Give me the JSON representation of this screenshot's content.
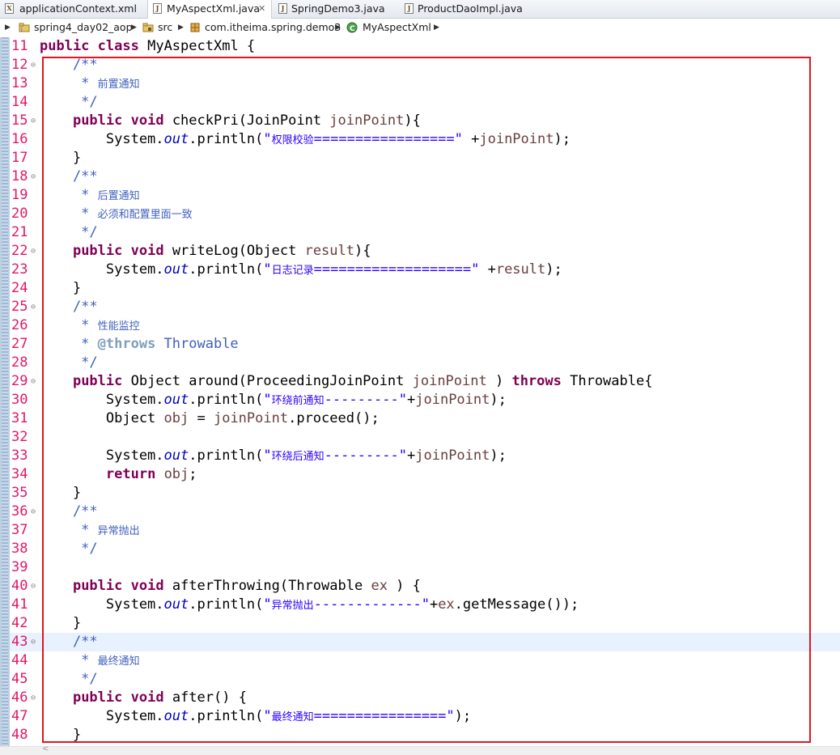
{
  "tabs": [
    {
      "label": "applicationContext.xml",
      "icon": "xml-file-icon",
      "glyph": "X",
      "active": false
    },
    {
      "label": "MyAspectXml.java",
      "icon": "java-file-icon",
      "glyph": "J",
      "active": true,
      "close": "✕"
    },
    {
      "label": "SpringDemo3.java",
      "icon": "java-file-icon",
      "glyph": "J",
      "active": false
    },
    {
      "label": "ProductDaoImpl.java",
      "icon": "java-file-icon",
      "glyph": "J",
      "active": false
    }
  ],
  "breadcrumb": [
    "spring4_day02_aop",
    "src",
    "com.itheima.spring.demo3",
    "MyAspectXml"
  ],
  "colors": {
    "line_number": "#e31669",
    "keyword": "#7f0055",
    "string": "#2a00ff",
    "javadoc": "#3f5fbf",
    "annotation_box": "#e0161e"
  },
  "highlighted_line": "43",
  "code": [
    {
      "n": "11",
      "f": "",
      "tokens": [
        [
          "kw",
          "public"
        ],
        [
          "",
          "​ "
        ],
        [
          "kw",
          "class"
        ],
        [
          "",
          " MyAspectXml {"
        ]
      ]
    },
    {
      "n": "12",
      "f": "⊖",
      "tokens": [
        [
          "dc",
          "    /**"
        ]
      ]
    },
    {
      "n": "13",
      "f": "",
      "tokens": [
        [
          "dc",
          "     * "
        ],
        [
          "dc zh",
          "前置通知"
        ]
      ]
    },
    {
      "n": "14",
      "f": "",
      "tokens": [
        [
          "dc",
          "     */"
        ]
      ]
    },
    {
      "n": "15",
      "f": "⊖",
      "tokens": [
        [
          "",
          "    "
        ],
        [
          "kw",
          "public"
        ],
        [
          "",
          " "
        ],
        [
          "kw",
          "void"
        ],
        [
          "",
          " checkPri(JoinPoint "
        ],
        [
          "var",
          "joinPoint"
        ],
        [
          "",
          "){"
        ]
      ]
    },
    {
      "n": "16",
      "f": "",
      "tokens": [
        [
          "",
          "        System."
        ],
        [
          "fld",
          "out"
        ],
        [
          "",
          ".println("
        ],
        [
          "st",
          "\""
        ],
        [
          "st zh",
          "权限校验"
        ],
        [
          "st",
          "=================\""
        ],
        [
          "",
          " +"
        ],
        [
          "var",
          "joinPoint"
        ],
        [
          "",
          ");"
        ]
      ]
    },
    {
      "n": "17",
      "f": "",
      "tokens": [
        [
          "",
          "    }"
        ]
      ]
    },
    {
      "n": "18",
      "f": "⊖",
      "tokens": [
        [
          "dc",
          "    /**"
        ]
      ]
    },
    {
      "n": "19",
      "f": "",
      "tokens": [
        [
          "dc",
          "     * "
        ],
        [
          "dc zh",
          "后置通知"
        ]
      ]
    },
    {
      "n": "20",
      "f": "",
      "tokens": [
        [
          "dc",
          "     * "
        ],
        [
          "dc zh",
          "必须和配置里面一致"
        ]
      ]
    },
    {
      "n": "21",
      "f": "",
      "tokens": [
        [
          "dc",
          "     */"
        ]
      ]
    },
    {
      "n": "22",
      "f": "⊖",
      "tokens": [
        [
          "",
          "    "
        ],
        [
          "kw",
          "public"
        ],
        [
          "",
          " "
        ],
        [
          "kw",
          "void"
        ],
        [
          "",
          " writeLog(Object "
        ],
        [
          "var",
          "result"
        ],
        [
          "",
          "){"
        ]
      ]
    },
    {
      "n": "23",
      "f": "",
      "tokens": [
        [
          "",
          "        System."
        ],
        [
          "fld",
          "out"
        ],
        [
          "",
          ".println("
        ],
        [
          "st",
          "\""
        ],
        [
          "st zh",
          "日志记录"
        ],
        [
          "st",
          "===================\""
        ],
        [
          "",
          " +"
        ],
        [
          "var",
          "result"
        ],
        [
          "",
          ");"
        ]
      ]
    },
    {
      "n": "24",
      "f": "",
      "tokens": [
        [
          "",
          "    }"
        ]
      ]
    },
    {
      "n": "25",
      "f": "⊖",
      "tokens": [
        [
          "dc",
          "    /**"
        ]
      ]
    },
    {
      "n": "26",
      "f": "",
      "tokens": [
        [
          "dc",
          "     * "
        ],
        [
          "dc zh",
          "性能监控"
        ]
      ]
    },
    {
      "n": "27",
      "f": "",
      "tokens": [
        [
          "dc",
          "     * "
        ],
        [
          "tag",
          "@throws"
        ],
        [
          "dc",
          " Throwable"
        ]
      ]
    },
    {
      "n": "28",
      "f": "",
      "tokens": [
        [
          "dc",
          "     */"
        ]
      ]
    },
    {
      "n": "29",
      "f": "⊖",
      "tokens": [
        [
          "",
          "    "
        ],
        [
          "kw",
          "public"
        ],
        [
          "",
          " Object around(ProceedingJoinPoint "
        ],
        [
          "var",
          "joinPoint"
        ],
        [
          "",
          " ) "
        ],
        [
          "kw",
          "throws"
        ],
        [
          "",
          " Throwable{"
        ]
      ]
    },
    {
      "n": "30",
      "f": "",
      "tokens": [
        [
          "",
          "        System."
        ],
        [
          "fld",
          "out"
        ],
        [
          "",
          ".println("
        ],
        [
          "st",
          "\""
        ],
        [
          "st zh",
          "环绕前通知"
        ],
        [
          "st",
          "---------\""
        ],
        [
          "",
          "+"
        ],
        [
          "var",
          "joinPoint"
        ],
        [
          "",
          ");"
        ]
      ]
    },
    {
      "n": "31",
      "f": "",
      "tokens": [
        [
          "",
          "        Object "
        ],
        [
          "var",
          "obj"
        ],
        [
          "",
          " = "
        ],
        [
          "var",
          "joinPoint"
        ],
        [
          "",
          ".proceed();"
        ]
      ]
    },
    {
      "n": "32",
      "f": "",
      "tokens": [
        [
          "",
          ""
        ]
      ]
    },
    {
      "n": "33",
      "f": "",
      "tokens": [
        [
          "",
          "        System."
        ],
        [
          "fld",
          "out"
        ],
        [
          "",
          ".println("
        ],
        [
          "st",
          "\""
        ],
        [
          "st zh",
          "环绕后通知"
        ],
        [
          "st",
          "---------\""
        ],
        [
          "",
          "+"
        ],
        [
          "var",
          "joinPoint"
        ],
        [
          "",
          ");"
        ]
      ]
    },
    {
      "n": "34",
      "f": "",
      "tokens": [
        [
          "",
          "        "
        ],
        [
          "kw",
          "return"
        ],
        [
          "",
          " "
        ],
        [
          "var",
          "obj"
        ],
        [
          "",
          ";"
        ]
      ]
    },
    {
      "n": "35",
      "f": "",
      "tokens": [
        [
          "",
          "    }"
        ]
      ]
    },
    {
      "n": "36",
      "f": "⊖",
      "tokens": [
        [
          "dc",
          "    /**"
        ]
      ]
    },
    {
      "n": "37",
      "f": "",
      "tokens": [
        [
          "dc",
          "     * "
        ],
        [
          "dc zh",
          "异常抛出"
        ]
      ]
    },
    {
      "n": "38",
      "f": "",
      "tokens": [
        [
          "dc",
          "     */"
        ]
      ]
    },
    {
      "n": "39",
      "f": "",
      "tokens": [
        [
          "",
          ""
        ]
      ]
    },
    {
      "n": "40",
      "f": "⊖",
      "tokens": [
        [
          "",
          "    "
        ],
        [
          "kw",
          "public"
        ],
        [
          "",
          " "
        ],
        [
          "kw",
          "void"
        ],
        [
          "",
          " afterThrowing(Throwable "
        ],
        [
          "var",
          "ex"
        ],
        [
          "",
          " ) {"
        ]
      ]
    },
    {
      "n": "41",
      "f": "",
      "tokens": [
        [
          "",
          "        System."
        ],
        [
          "fld",
          "out"
        ],
        [
          "",
          ".println("
        ],
        [
          "st",
          "\""
        ],
        [
          "st zh",
          "异常抛出"
        ],
        [
          "st",
          "-------------\""
        ],
        [
          "",
          "+"
        ],
        [
          "var",
          "ex"
        ],
        [
          "",
          ".getMessage());"
        ]
      ]
    },
    {
      "n": "42",
      "f": "",
      "tokens": [
        [
          "",
          "    }"
        ]
      ]
    },
    {
      "n": "43",
      "f": "⊖",
      "tokens": [
        [
          "dc",
          "    /**"
        ]
      ]
    },
    {
      "n": "44",
      "f": "",
      "tokens": [
        [
          "dc",
          "     * "
        ],
        [
          "dc zh",
          "最终通知"
        ]
      ]
    },
    {
      "n": "45",
      "f": "",
      "tokens": [
        [
          "dc",
          "     */"
        ]
      ]
    },
    {
      "n": "46",
      "f": "⊖",
      "tokens": [
        [
          "",
          "    "
        ],
        [
          "kw",
          "public"
        ],
        [
          "",
          " "
        ],
        [
          "kw",
          "void"
        ],
        [
          "",
          " after() {"
        ]
      ]
    },
    {
      "n": "47",
      "f": "",
      "tokens": [
        [
          "",
          "        System."
        ],
        [
          "fld",
          "out"
        ],
        [
          "",
          ".println("
        ],
        [
          "st",
          "\""
        ],
        [
          "st zh",
          "最终通知"
        ],
        [
          "st",
          "================\""
        ],
        [
          "",
          ");"
        ]
      ]
    },
    {
      "n": "48",
      "f": "",
      "tokens": [
        [
          "",
          "    }"
        ]
      ]
    }
  ]
}
